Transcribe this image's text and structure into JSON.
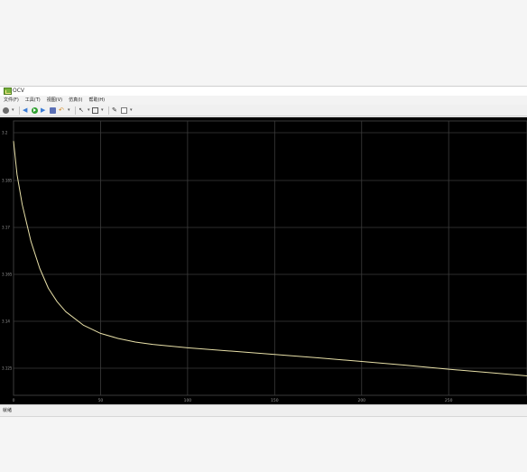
{
  "window": {
    "title": "OCV"
  },
  "menubar": {
    "items": [
      "文件(F)",
      "工具(T)",
      "视图(V)",
      "仿真(I)",
      "帮助(H)"
    ]
  },
  "toolbar": {
    "icons": [
      "gear-icon",
      "back-icon",
      "run-icon",
      "step-forward-icon",
      "stop-icon",
      "undo-icon",
      "cursor-icon",
      "zoom-icon",
      "pencil-icon",
      "edit-icon"
    ]
  },
  "chart_data": {
    "type": "line",
    "title": "",
    "xlabel": "",
    "ylabel": "",
    "xlim": [
      0,
      295
    ],
    "ylim": [
      3.122,
      3.204
    ],
    "x_ticks": [
      "0",
      "50",
      "100",
      "150",
      "200",
      "250"
    ],
    "y_ticks": [
      "3.2",
      "3.185",
      "3.17",
      "3.165",
      "3.14",
      "3.125"
    ],
    "grid": true,
    "series": [
      {
        "color": "#e8e0a8",
        "x": [
          0,
          2,
          5,
          10,
          15,
          20,
          25,
          30,
          40,
          50,
          60,
          70,
          80,
          100,
          125,
          150,
          175,
          200,
          225,
          250,
          275,
          295
        ],
        "y": [
          3.198,
          3.188,
          3.179,
          3.168,
          3.16,
          3.154,
          3.15,
          3.147,
          3.143,
          3.1405,
          3.139,
          3.1379,
          3.1372,
          3.1362,
          3.1352,
          3.1342,
          3.1332,
          3.1321,
          3.131,
          3.1298,
          3.1287,
          3.1278
        ]
      }
    ]
  },
  "statusbar": {
    "text": "就绪"
  }
}
